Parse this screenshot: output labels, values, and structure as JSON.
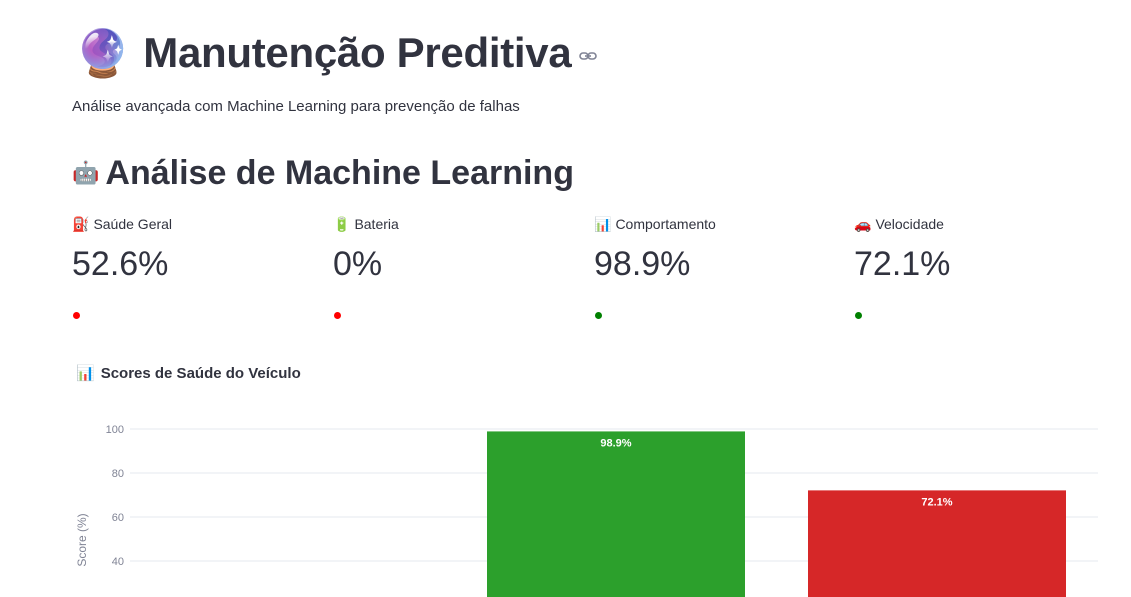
{
  "header": {
    "icon": "crystal-ball-icon",
    "title": "Manutenção Preditiva",
    "subtitle": "Análise avançada com Machine Learning para prevenção de falhas"
  },
  "section": {
    "icon": "robot-icon",
    "title": "Análise de Machine Learning"
  },
  "metrics": [
    {
      "icon": "fuel-pump-icon",
      "label": "Saúde Geral",
      "value": "52.6%",
      "status_color": "#ff0000"
    },
    {
      "icon": "battery-icon",
      "label": "Bateria",
      "value": "0%",
      "status_color": "#ff0000"
    },
    {
      "icon": "bar-chart-icon",
      "label": "Comportamento",
      "value": "98.9%",
      "status_color": "#008000"
    },
    {
      "icon": "car-icon",
      "label": "Velocidade",
      "value": "72.1%",
      "status_color": "#008000"
    }
  ],
  "chart_section": {
    "icon": "bar-chart-icon",
    "title": "Scores de Saúde do Veículo"
  },
  "chart_data": {
    "type": "bar",
    "ylabel": "Score (%)",
    "y_ticks_visible": [
      40,
      60,
      80,
      100
    ],
    "grid": true,
    "series": [
      {
        "values": [
          98.9,
          72.1
        ],
        "colors": [
          "#2ca02c",
          "#d62728"
        ],
        "labels": [
          "98.9%",
          "72.1%"
        ]
      }
    ]
  }
}
